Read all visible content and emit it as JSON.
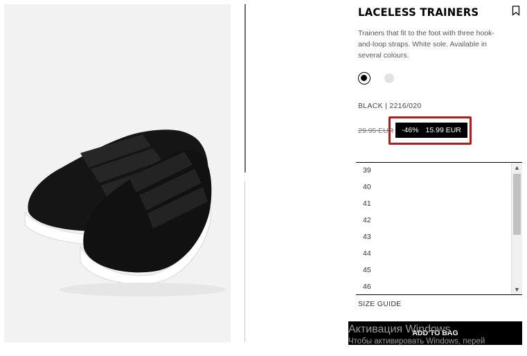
{
  "product": {
    "title": "LACELESS TRAINERS",
    "description": "Trainers that fit to the foot with three hook-and-loop straps. White sole. Available in several colours.",
    "color_ref": "BLACK | 2216/020",
    "colors": [
      {
        "name": "black",
        "hex": "#000000",
        "selected": true
      },
      {
        "name": "white",
        "hex": "#e2e2e2",
        "selected": false
      }
    ]
  },
  "price": {
    "old": "29.95 EUR",
    "discount": "-46%",
    "new": "15.99 EUR",
    "highlight_color": "#b81a1a"
  },
  "sizes": [
    "39",
    "40",
    "41",
    "42",
    "43",
    "44",
    "45",
    "46"
  ],
  "size_guide_label": "SIZE GUIDE",
  "add_to_bag_label": "ADD TO BAG",
  "icons": {
    "bookmark": "bookmark-icon",
    "scroll_up": "chevron-up-icon",
    "scroll_down": "chevron-down-icon"
  },
  "watermark": {
    "title": "Активация Windows",
    "subtitle": "Чтобы активировать Windows, перей"
  }
}
